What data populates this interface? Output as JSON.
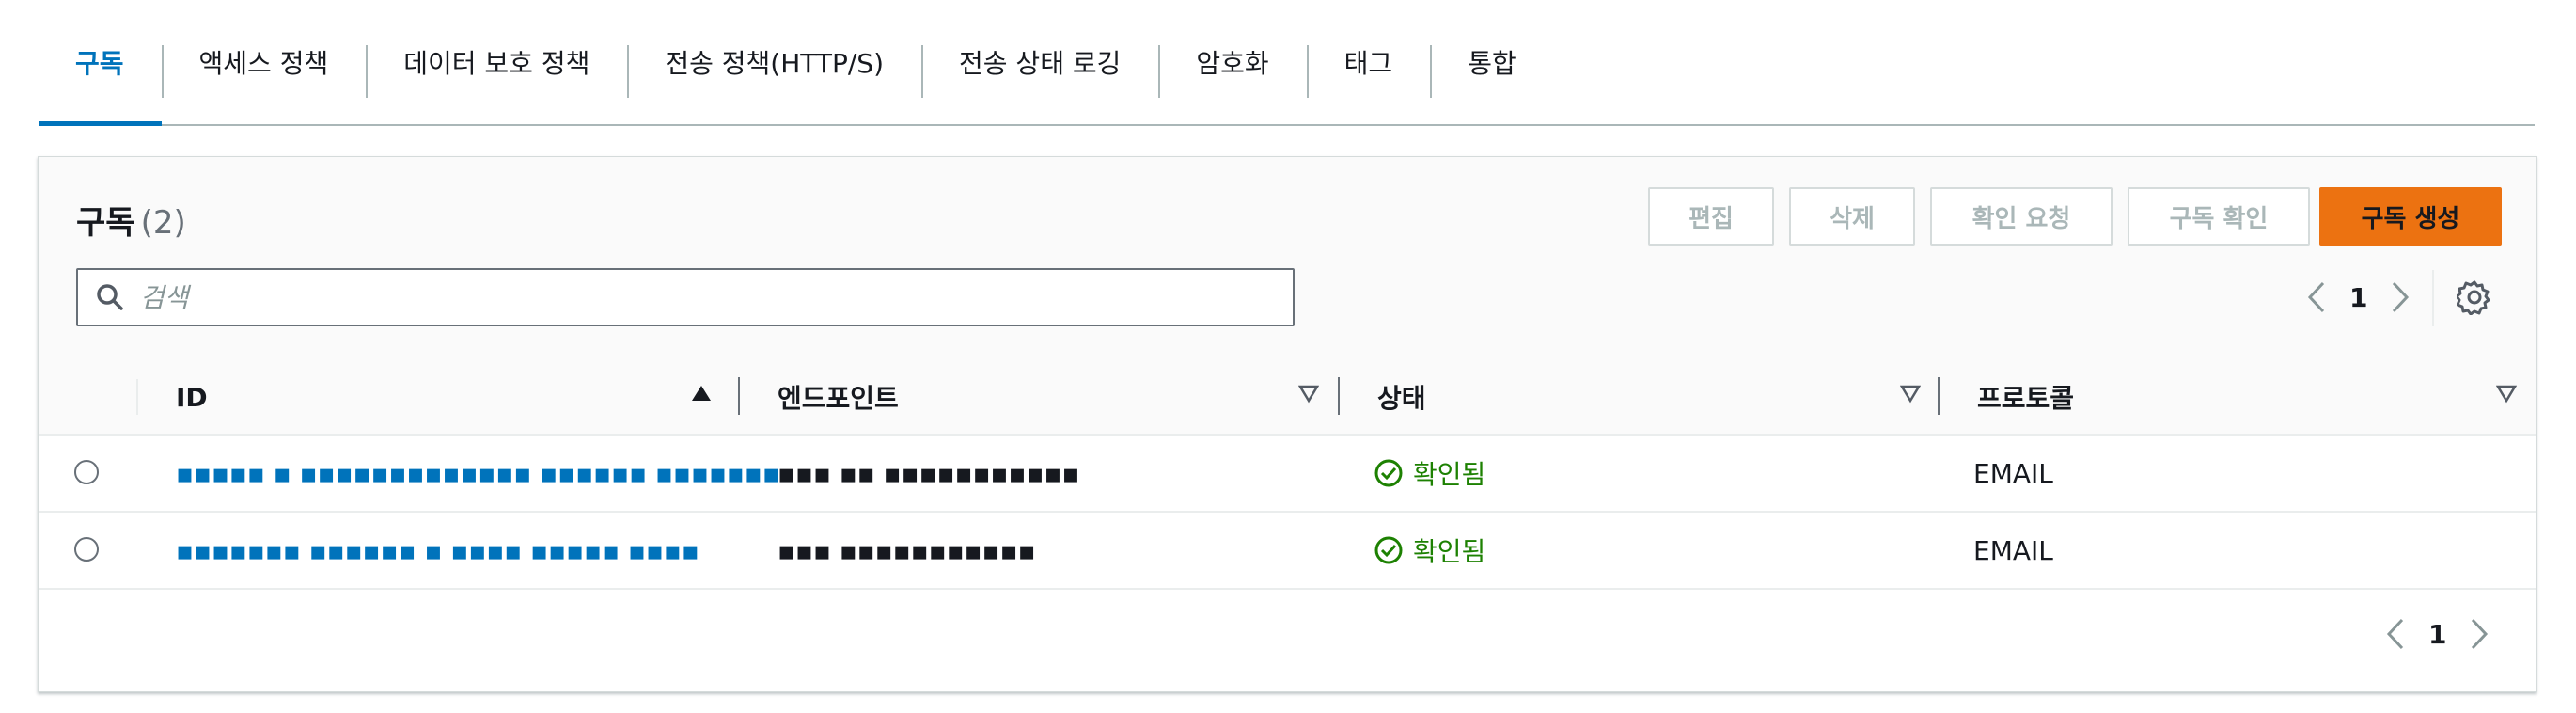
{
  "tabs": [
    {
      "label": "구독"
    },
    {
      "label": "액세스 정책"
    },
    {
      "label": "데이터 보호 정책"
    },
    {
      "label": "전송 정책(HTTP/S)"
    },
    {
      "label": "전송 상태 로깅"
    },
    {
      "label": "암호화"
    },
    {
      "label": "태그"
    },
    {
      "label": "통합"
    }
  ],
  "panel": {
    "title": "구독",
    "count": "(2)",
    "buttons": {
      "edit": "편집",
      "delete": "삭제",
      "request_confirmation": "확인 요청",
      "confirm_subscription": "구독 확인",
      "create_subscription": "구독 생성"
    },
    "search": {
      "placeholder": "검색",
      "value": ""
    },
    "pagination": {
      "current_page": "1"
    }
  },
  "table": {
    "columns": [
      "ID",
      "엔드포인트",
      "상태",
      "프로토콜"
    ],
    "rows": [
      {
        "id": "▪▪▪▪▪ ▪ ▪▪▪▪▪▪▪▪▪▪▪▪▪ ▪▪▪▪▪▪ ▪▪▪▪▪▪▪",
        "endpoint": "▪▪▪ ▪▪ ▪▪▪▪▪▪▪▪▪▪▪",
        "status": "확인됨",
        "protocol": "EMAIL"
      },
      {
        "id": "▪▪▪▪▪▪▪ ▪▪▪▪▪▪ ▪ ▪▪▪▪ ▪▪▪▪▪ ▪▪▪▪",
        "endpoint": "▪▪▪ ▪▪▪▪▪▪▪▪▪▪▪",
        "status": "확인됨",
        "protocol": "EMAIL"
      }
    ]
  },
  "colors": {
    "accent": "#0073bb",
    "primary_button": "#ec7211",
    "status_success": "#1d8102",
    "disabled_text": "#aab7b8"
  },
  "icons": [
    "search-icon",
    "chevron-left-icon",
    "chevron-right-icon",
    "gear-icon",
    "sort-ascending-icon",
    "sort-descending-icon",
    "check-circle-icon"
  ]
}
